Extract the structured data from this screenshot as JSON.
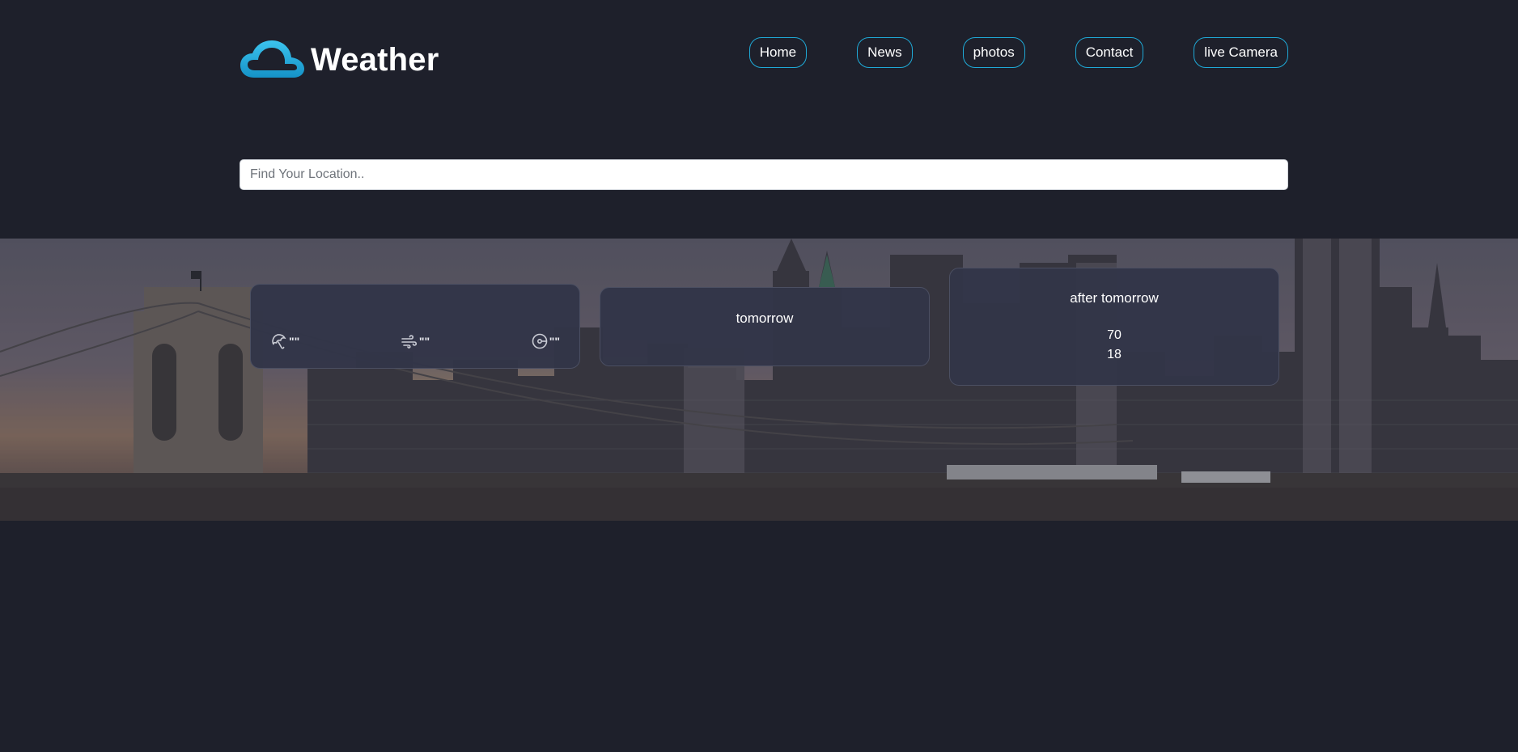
{
  "header": {
    "logo_text": "Weather",
    "logo_icon": "cloud-icon",
    "accent_color": "#1fa9d6"
  },
  "nav": {
    "items": [
      {
        "label": "Home"
      },
      {
        "label": "News"
      },
      {
        "label": "photos"
      },
      {
        "label": "Contact"
      },
      {
        "label": "live Camera"
      }
    ]
  },
  "search": {
    "placeholder": "Find Your Location..",
    "value": ""
  },
  "forecast": {
    "today": {
      "stats": [
        {
          "icon": "umbrella-icon",
          "value": "\"\""
        },
        {
          "icon": "wind-icon",
          "value": "\"\""
        },
        {
          "icon": "compass-icon",
          "value": "\"\""
        }
      ]
    },
    "tomorrow": {
      "title": "tomorrow"
    },
    "after_tomorrow": {
      "title": "after tomorrow",
      "max_temp": "70",
      "min_temp": "18"
    }
  },
  "colors": {
    "page_background": "#1e202b",
    "card_background": "#323548"
  }
}
